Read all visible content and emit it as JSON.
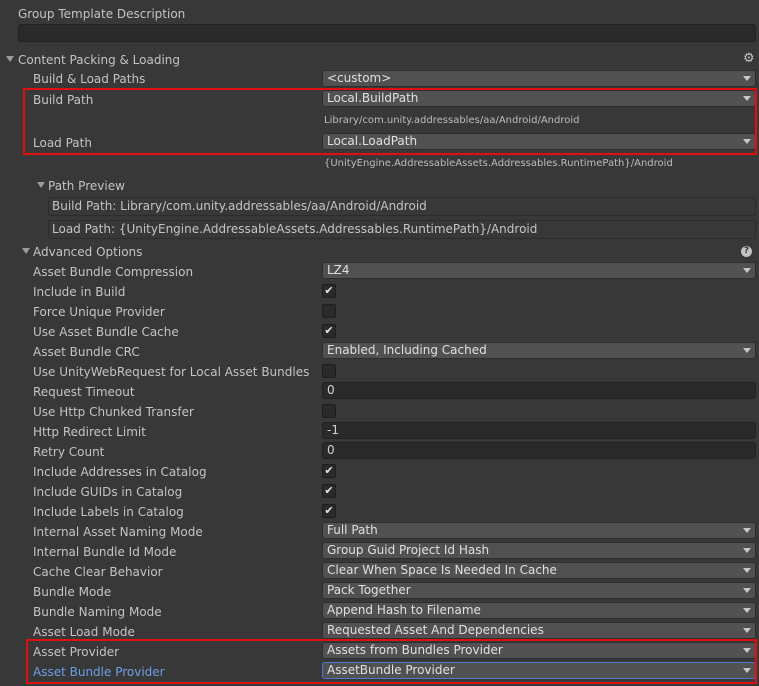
{
  "group_template": {
    "label": "Group Template Description",
    "value": ""
  },
  "content_packing": {
    "title": "Content Packing & Loading",
    "gear_icon": "gear-icon",
    "build_load_paths": {
      "label": "Build & Load Paths",
      "value": "<custom>"
    },
    "build_path": {
      "label": "Build Path",
      "value": "Local.BuildPath",
      "resolved": "Library/com.unity.addressables/aa/Android/Android"
    },
    "load_path": {
      "label": "Load Path",
      "value": "Local.LoadPath",
      "resolved": "{UnityEngine.AddressableAssets.Addressables.RuntimePath}/Android"
    },
    "path_preview": {
      "title": "Path Preview",
      "build": "Build Path: Library/com.unity.addressables/aa/Android/Android",
      "load": "Load Path: {UnityEngine.AddressableAssets.Addressables.RuntimePath}/Android"
    }
  },
  "advanced": {
    "title": "Advanced Options",
    "help_icon": "help-icon",
    "compression": {
      "label": "Asset Bundle Compression",
      "value": "LZ4"
    },
    "include_in_build": {
      "label": "Include in Build",
      "checked": "✔"
    },
    "force_unique_provider": {
      "label": "Force Unique Provider",
      "checked": ""
    },
    "use_cache": {
      "label": "Use Asset Bundle Cache",
      "checked": "✔"
    },
    "crc": {
      "label": "Asset Bundle CRC",
      "value": "Enabled, Including Cached"
    },
    "use_uwr": {
      "label": "Use UnityWebRequest for Local Asset Bundles",
      "checked": ""
    },
    "request_timeout": {
      "label": "Request Timeout",
      "value": "0"
    },
    "chunked": {
      "label": "Use Http Chunked Transfer",
      "checked": ""
    },
    "redirect_limit": {
      "label": "Http Redirect Limit",
      "value": "-1"
    },
    "retry_count": {
      "label": "Retry Count",
      "value": "0"
    },
    "include_addresses": {
      "label": "Include Addresses in Catalog",
      "checked": "✔"
    },
    "include_guids": {
      "label": "Include GUIDs in Catalog",
      "checked": "✔"
    },
    "include_labels": {
      "label": "Include Labels in Catalog",
      "checked": "✔"
    },
    "asset_naming": {
      "label": "Internal Asset Naming Mode",
      "value": "Full Path"
    },
    "bundle_id_mode": {
      "label": "Internal Bundle Id Mode",
      "value": "Group Guid Project Id Hash"
    },
    "cache_clear": {
      "label": "Cache Clear Behavior",
      "value": "Clear When Space Is Needed In Cache"
    },
    "bundle_mode": {
      "label": "Bundle Mode",
      "value": "Pack Together"
    },
    "bundle_naming": {
      "label": "Bundle Naming Mode",
      "value": "Append Hash to Filename"
    },
    "load_mode": {
      "label": "Asset Load Mode",
      "value": "Requested Asset And Dependencies"
    },
    "asset_provider": {
      "label": "Asset Provider",
      "value": "Assets from Bundles Provider"
    },
    "bundle_provider": {
      "label": "Asset Bundle Provider",
      "value": "AssetBundle Provider"
    }
  },
  "colors": {
    "highlight_box": "#e01010",
    "selected_label": "#6e9de8"
  }
}
